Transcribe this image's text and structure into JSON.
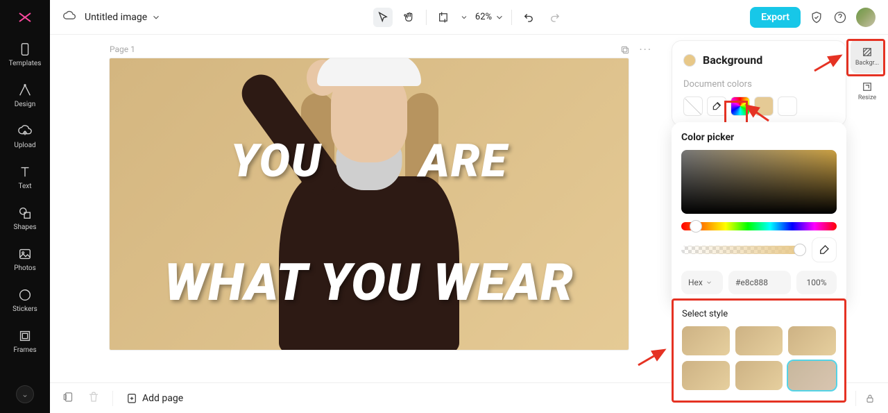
{
  "rail": {
    "items": [
      {
        "label": "Templates",
        "icon": "templates"
      },
      {
        "label": "Design",
        "icon": "design"
      },
      {
        "label": "Upload",
        "icon": "upload"
      },
      {
        "label": "Text",
        "icon": "text"
      },
      {
        "label": "Shapes",
        "icon": "shapes"
      },
      {
        "label": "Photos",
        "icon": "photos"
      },
      {
        "label": "Stickers",
        "icon": "stickers"
      },
      {
        "label": "Frames",
        "icon": "frames"
      }
    ]
  },
  "topbar": {
    "doc_title": "Untitled image",
    "zoom": "62%",
    "export": "Export"
  },
  "canvas": {
    "page_label": "Page 1",
    "slogan_line1_a": "YOU",
    "slogan_line1_b": "ARE",
    "slogan_line2": "WHAT YOU WEAR"
  },
  "bottom": {
    "add_page": "Add page"
  },
  "proprail": {
    "background": "Backgr...",
    "resize": "Resize"
  },
  "panel": {
    "title": "Background",
    "doc_colors": "Document colors"
  },
  "picker": {
    "title": "Color picker",
    "hex_mode": "Hex",
    "hex_value": "#e8c888",
    "opacity": "100%"
  },
  "style": {
    "title": "Select style"
  }
}
